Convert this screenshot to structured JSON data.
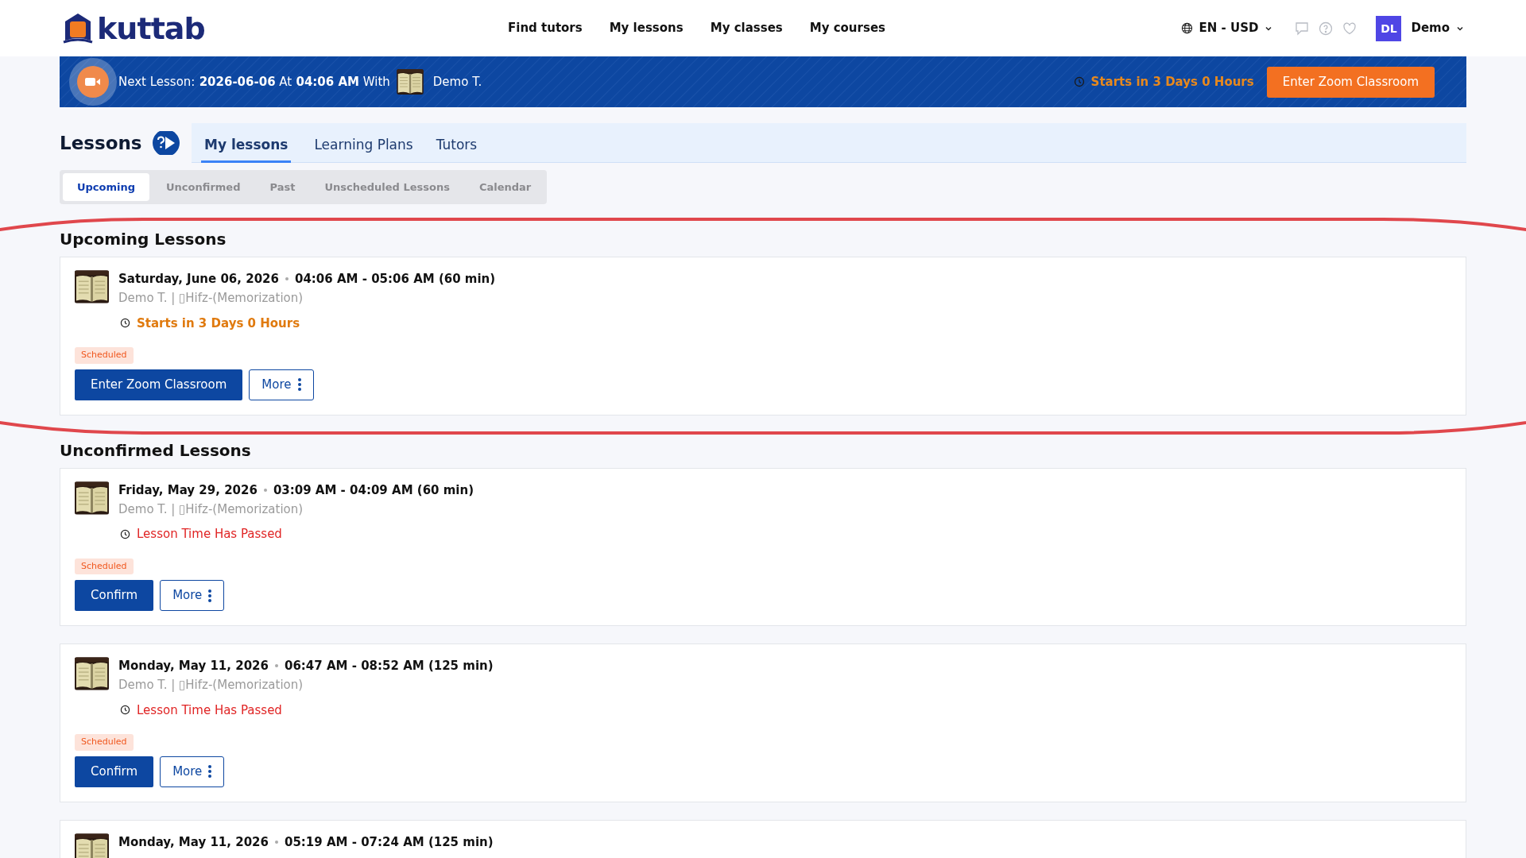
{
  "header": {
    "logo": "kuttab",
    "nav": [
      {
        "label": "Find tutors"
      },
      {
        "label": "My lessons"
      },
      {
        "label": "My classes"
      },
      {
        "label": "My courses"
      }
    ],
    "locale": "EN - USD",
    "avatar": "DL",
    "user": "Demo"
  },
  "banner": {
    "prefix": "Next Lesson:",
    "date": "2026-06-06",
    "at": "At",
    "time": "04:06 AM",
    "with": "With",
    "tutor": "Demo T.",
    "countdown": "Starts in 3 Days 0 Hours",
    "button": "Enter Zoom Classroom"
  },
  "page_title": "Lessons",
  "tabs": [
    {
      "label": "My lessons",
      "selected": true
    },
    {
      "label": "Learning Plans",
      "selected": false
    },
    {
      "label": "Tutors",
      "selected": false
    }
  ],
  "subtabs": [
    {
      "label": "Upcoming",
      "selected": true
    },
    {
      "label": "Unconfirmed",
      "selected": false
    },
    {
      "label": "Past",
      "selected": false
    },
    {
      "label": "Unscheduled Lessons",
      "selected": false
    },
    {
      "label": "Calendar",
      "selected": false
    }
  ],
  "annotation": {
    "kind": "ellipse",
    "color": "#e0474c"
  },
  "sections": [
    {
      "title": "Upcoming Lessons",
      "lessons": [
        {
          "date": "Saturday, June 06, 2026",
          "time": "04:06 AM - 05:06 AM (60 min)",
          "subtitle": "Demo T. | ▯Hifz-(Memorization)",
          "status": {
            "kind": "upcoming",
            "text": "Starts in 3 Days 0 Hours"
          },
          "badge": "Scheduled",
          "primary": "Enter Zoom Classroom",
          "more": "More"
        }
      ]
    },
    {
      "title": "Unconfirmed Lessons",
      "lessons": [
        {
          "date": "Friday, May 29, 2026",
          "time": "03:09 AM - 04:09 AM (60 min)",
          "subtitle": "Demo T. | ▯Hifz-(Memorization)",
          "status": {
            "kind": "passed",
            "text": "Lesson Time Has Passed"
          },
          "badge": "Scheduled",
          "primary": "Confirm",
          "more": "More"
        },
        {
          "date": "Monday, May 11, 2026",
          "time": "06:47 AM - 08:52 AM (125 min)",
          "subtitle": "Demo T. | ▯Hifz-(Memorization)",
          "status": {
            "kind": "passed",
            "text": "Lesson Time Has Passed"
          },
          "badge": "Scheduled",
          "primary": "Confirm",
          "more": "More"
        },
        {
          "date": "Monday, May 11, 2026",
          "time": "05:19 AM - 07:24 AM (125 min)"
        }
      ]
    }
  ]
}
